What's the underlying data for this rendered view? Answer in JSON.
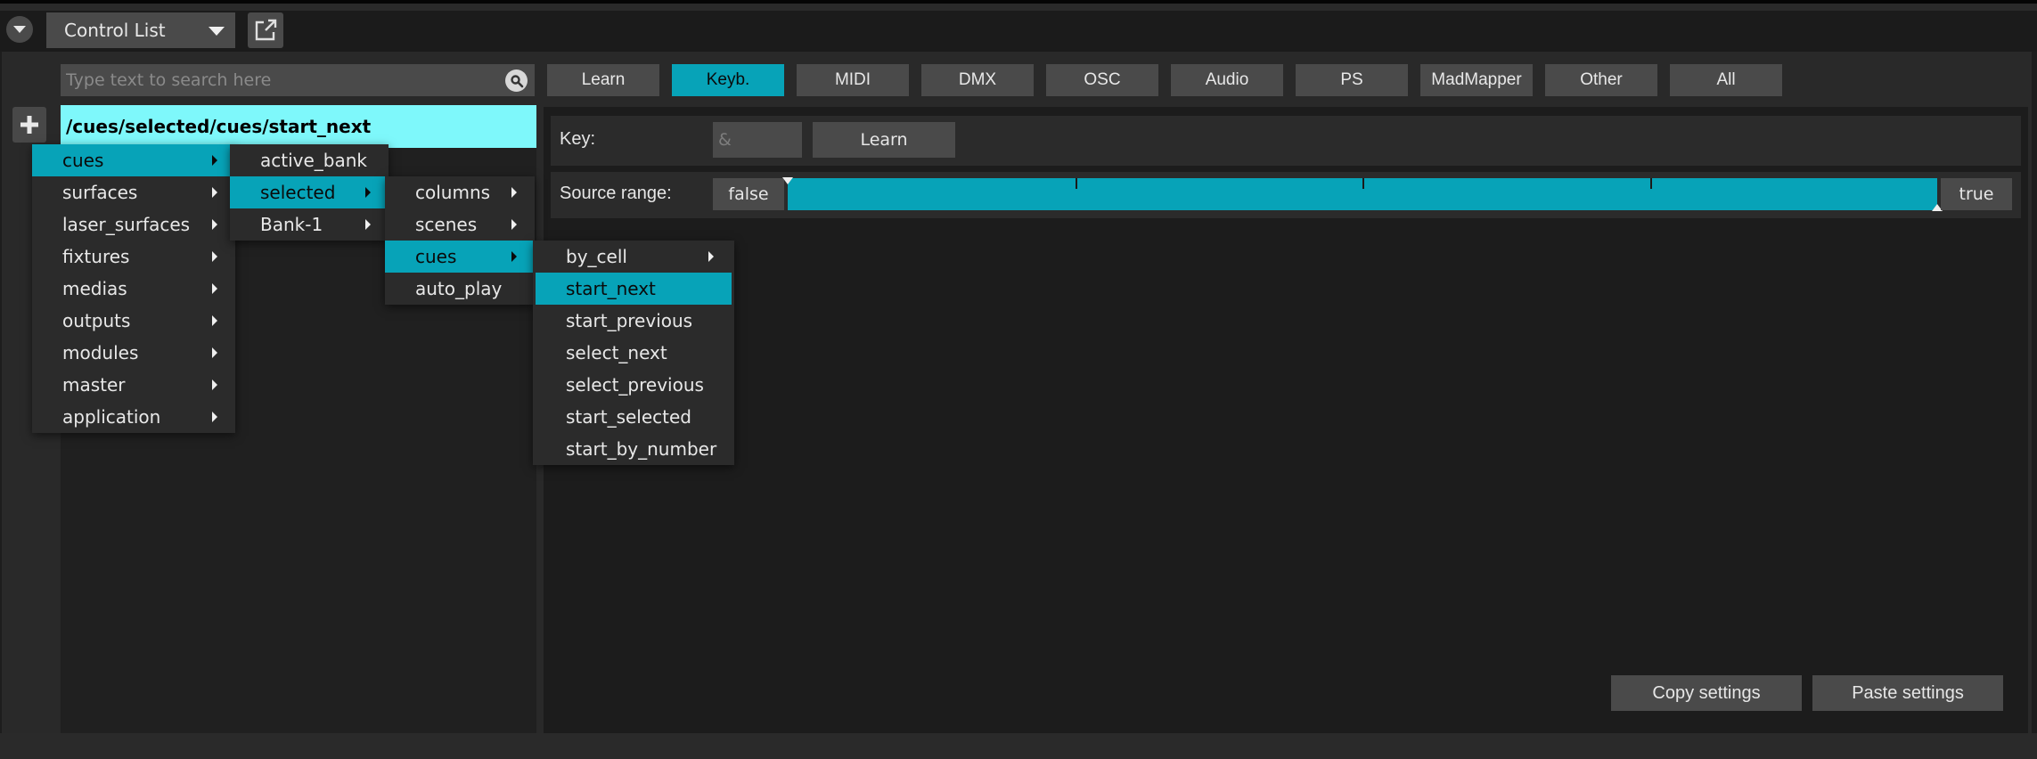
{
  "header": {
    "panel_selector": "Control List",
    "collapse_icon": "chevron-down-icon",
    "popout_icon": "external-window-icon"
  },
  "search": {
    "placeholder": "Type text to search here",
    "value": "",
    "icon": "search-icon"
  },
  "add_icon": "plus-icon",
  "path": "/cues/selected/cues/start_next",
  "tabs": [
    {
      "label": "Learn",
      "active": false
    },
    {
      "label": "Keyb.",
      "active": true
    },
    {
      "label": "MIDI",
      "active": false
    },
    {
      "label": "DMX",
      "active": false
    },
    {
      "label": "OSC",
      "active": false
    },
    {
      "label": "Audio",
      "active": false
    },
    {
      "label": "PS",
      "active": false
    },
    {
      "label": "MadMapper",
      "active": false
    },
    {
      "label": "Other",
      "active": false
    },
    {
      "label": "All",
      "active": false
    }
  ],
  "key_row": {
    "label": "Key:",
    "placeholder": "&",
    "learn_label": "Learn"
  },
  "source_range": {
    "label": "Source range:",
    "min_label": "false",
    "max_label": "true",
    "range_start": 0.0,
    "range_end": 1.0
  },
  "menus": {
    "level1": [
      {
        "label": "cues",
        "submenu": true,
        "highlighted": true
      },
      {
        "label": "surfaces",
        "submenu": true
      },
      {
        "label": "laser_surfaces",
        "submenu": true
      },
      {
        "label": "fixtures",
        "submenu": true
      },
      {
        "label": "medias",
        "submenu": true
      },
      {
        "label": "outputs",
        "submenu": true
      },
      {
        "label": "modules",
        "submenu": true
      },
      {
        "label": "master",
        "submenu": true
      },
      {
        "label": "application",
        "submenu": true
      }
    ],
    "level2": [
      {
        "label": "active_bank",
        "submenu": false
      },
      {
        "label": "selected",
        "submenu": true,
        "highlighted": true
      },
      {
        "label": "Bank-1",
        "submenu": true
      }
    ],
    "level3": [
      {
        "label": "columns",
        "submenu": true
      },
      {
        "label": "scenes",
        "submenu": true
      },
      {
        "label": "cues",
        "submenu": true,
        "highlighted": true
      },
      {
        "label": "auto_play",
        "submenu": false
      }
    ],
    "level4": [
      {
        "label": "by_cell",
        "submenu": true
      },
      {
        "label": "start_next",
        "submenu": false,
        "highlighted": true
      },
      {
        "label": "start_previous",
        "submenu": false
      },
      {
        "label": "select_next",
        "submenu": false
      },
      {
        "label": "select_previous",
        "submenu": false
      },
      {
        "label": "start_selected",
        "submenu": false
      },
      {
        "label": "start_by_number",
        "submenu": false
      }
    ]
  },
  "actions": {
    "copy_label": "Copy settings",
    "paste_label": "Paste settings"
  },
  "colors": {
    "accent": "#07a3b8",
    "path_highlight": "#7ef8fb",
    "button_bg": "#4a4a4a",
    "panel_bg": "#292929"
  }
}
